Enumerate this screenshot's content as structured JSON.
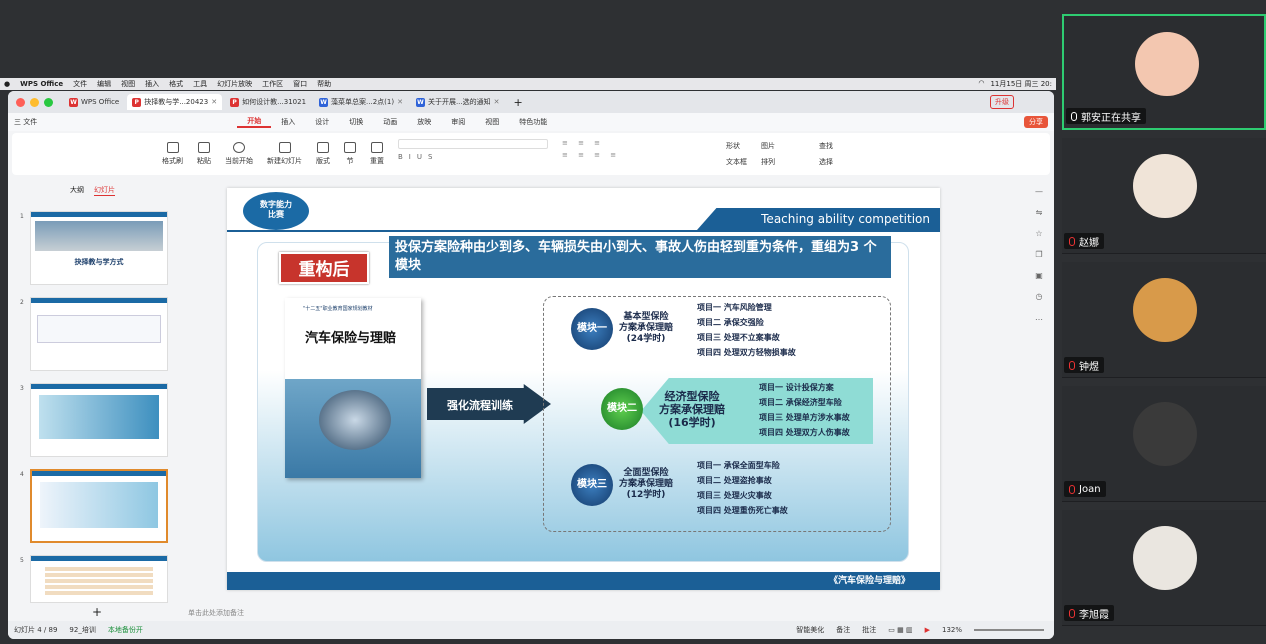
{
  "mac_menu": {
    "app": "WPS Office",
    "items": [
      "文件",
      "编辑",
      "视图",
      "插入",
      "格式",
      "工具",
      "幻灯片放映",
      "工作区",
      "窗口",
      "帮助"
    ],
    "datetime": "11月15日 周三 20:"
  },
  "tabs": [
    {
      "label": "WPS Office",
      "icon": "W",
      "color": "#d33"
    },
    {
      "label": "抉择教与学...20423",
      "icon": "P",
      "color": "#d33"
    },
    {
      "label": "如何设计教...31021",
      "icon": "P",
      "color": "#d33"
    },
    {
      "label": "藻菜单总案...2点(1)",
      "icon": "W",
      "color": "#2f63d8"
    },
    {
      "label": "关于开展...选的通知",
      "icon": "W",
      "color": "#2f63d8"
    }
  ],
  "upgrade_btn": "升级",
  "share_btn": "分享",
  "file_menu": "三 文件",
  "ribbon_tabs": [
    "开始",
    "插入",
    "设计",
    "切换",
    "动画",
    "放映",
    "审阅",
    "视图",
    "特色功能"
  ],
  "ribbon": {
    "format_painter": "格式刷",
    "paste": "粘贴",
    "play_from": "当前开始",
    "new_slide": "新建幻灯片",
    "layout": "版式",
    "section": "节",
    "reset": "重置",
    "shape": "形状",
    "picture": "图片",
    "textbox": "文本框",
    "arrange": "排列",
    "find": "查找",
    "select": "选择"
  },
  "panel": {
    "outline_tab": "大纲",
    "slides_tab": "幻灯片",
    "add": "+"
  },
  "slide_numbers": [
    "1",
    "2",
    "3",
    "4",
    "5"
  ],
  "thumb1_title": "抉择教与学方式",
  "slide": {
    "logo_line1": "数字能力",
    "logo_line2": "比赛",
    "banner": "Teaching ability competition",
    "headline": "投保方案险种由少到多、车辆损失由小到大、事故人伤由轻到重为条件，重组为3 个模块",
    "after_label": "重构后",
    "book_title": "汽车保险与理赔",
    "book_header": "\"十二五\"职业教育国家规划教材",
    "arrow_label": "强化流程训练",
    "modules": [
      {
        "badge": "模块一",
        "name": "基本型保险\n方案承保理赔\n(24学时)",
        "items": [
          "项目一  汽车风险管理",
          "项目二  承保交强险",
          "项目三  处理不立案事故",
          "项目四  处理双方轻物损事故"
        ]
      },
      {
        "badge": "模块二",
        "name": "经济型保险\n方案承保理赔\n(16学时)",
        "items": [
          "项目一  设计投保方案",
          "项目二  承保经济型车险",
          "项目三  处理单方涉水事故",
          "项目四  处理双方人伤事故"
        ]
      },
      {
        "badge": "模块三",
        "name": "全面型保险\n方案承保理赔\n(12学时)",
        "items": [
          "项目一  承保全面型车险",
          "项目二  处理盗抢事故",
          "项目三  处理火灾事故",
          "项目四  处理重伤死亡事故"
        ]
      }
    ],
    "footer": "《汽车保险与理赔》"
  },
  "notes_placeholder": "单击此处添加备注",
  "status": {
    "page": "幻灯片 4 / 89",
    "template": "92_培训",
    "backup": "本地备份开",
    "beautify": "智能美化",
    "notes": "备注",
    "comment": "批注",
    "zoom": "132%"
  },
  "participants": [
    {
      "name": "郭安正在共享",
      "mic": "on",
      "color": "#f3c7b0"
    },
    {
      "name": "赵娜",
      "mic": "off",
      "color": "#f0e4d8"
    },
    {
      "name": "钟煜",
      "mic": "off",
      "color": "#d89a4a"
    },
    {
      "name": "Joan",
      "mic": "off",
      "color": "#3a3a3a"
    },
    {
      "name": "李旭霞",
      "mic": "off",
      "color": "#eae6e0"
    }
  ],
  "colors": {
    "accent": "#d33",
    "active_share": "#2ecc71",
    "slide_blue": "#1b6aa5",
    "teal": "#6dd0c8"
  }
}
